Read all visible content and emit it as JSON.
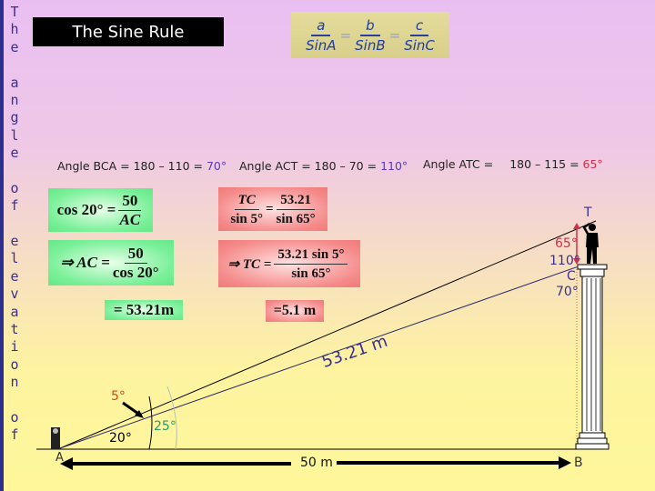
{
  "sidebar": {
    "vertical_text": [
      "T",
      "h",
      "e",
      "",
      "a",
      "n",
      "g",
      "l",
      "e",
      "",
      "o",
      "f",
      "",
      "e",
      "l",
      "e",
      "v",
      "a",
      "t",
      "i",
      "o",
      "n",
      "",
      "o",
      "f"
    ]
  },
  "title": "The Sine Rule",
  "sine_rule": {
    "a": "a",
    "sinA": "SinA",
    "b": "b",
    "sinB": "SinB",
    "c": "c",
    "sinC": "SinC",
    "eq": "="
  },
  "angles": {
    "bca_label": "Angle BCA = ",
    "bca_calc": "180 – 110 = ",
    "bca_result": "70°",
    "act_label": "Angle ACT = ",
    "act_calc": "180 – 70 = ",
    "act_result": "110°",
    "atc_label": "Angle ATC = ",
    "atc_calc": "180 – 115 = ",
    "atc_result": "65°"
  },
  "green_steps": {
    "s1_left": "cos 20° =",
    "s1_num": "50",
    "s1_den": "AC",
    "s2_left": "⇒ AC =",
    "s2_num": "50",
    "s2_den": "cos 20°",
    "s3": "= 53.21m"
  },
  "red_steps": {
    "s1_lnum": "TC",
    "s1_lden": "sin 5°",
    "s1_eq": "=",
    "s1_rnum": "53.21",
    "s1_rden": "sin 65°",
    "s2_left": "⇒ TC =",
    "s2_num": "53.21 sin 5°",
    "s2_den": "sin 65°",
    "s3": "=5.1 m"
  },
  "diagram": {
    "point_T": "T",
    "point_C": "C",
    "point_A": "A",
    "point_B": "B",
    "angle_T": "65°",
    "angle_C_top": "110°",
    "angle_C_bottom": "70°",
    "angle_5": "5°",
    "angle_20": "20°",
    "angle_25": "25°",
    "hyp_label": "53.21 m",
    "base_label": "50 m",
    "colors": {
      "red": "#d0304a",
      "purple": "#3a2f8a",
      "green": "#2a9a6a",
      "orange": "#d04a1a"
    }
  }
}
